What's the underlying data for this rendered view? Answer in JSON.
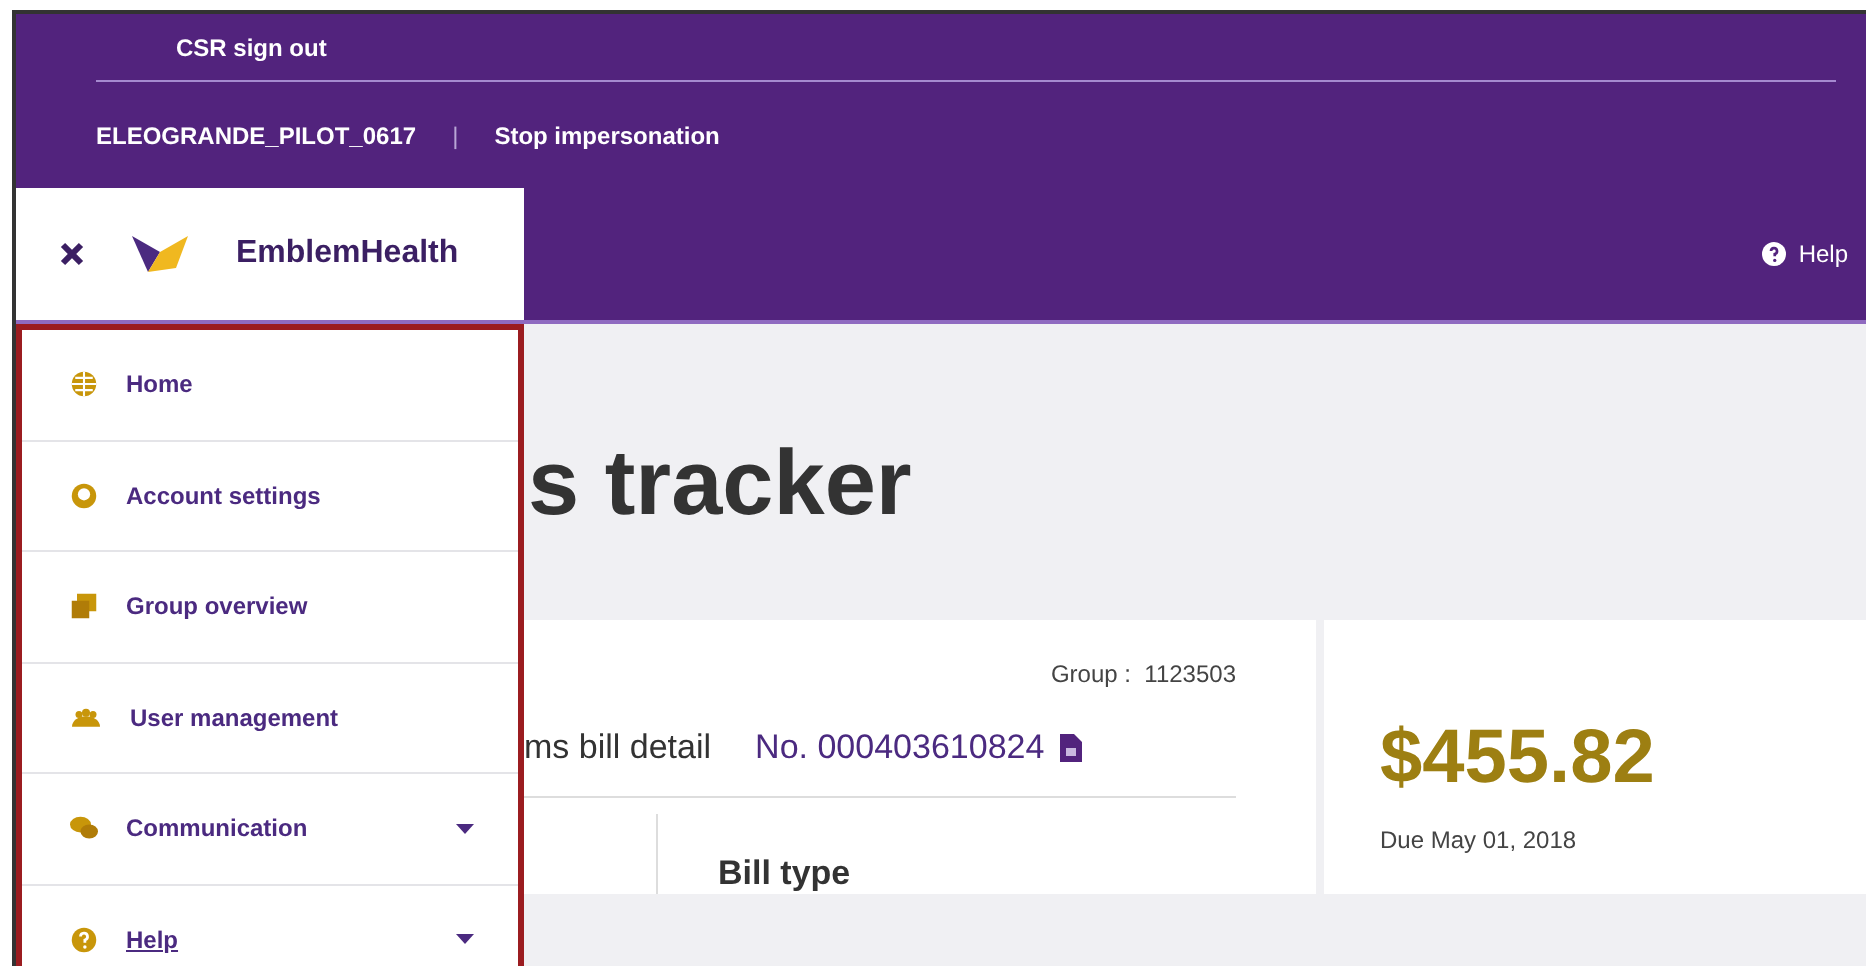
{
  "top_bar": {
    "sign_out": "CSR sign out",
    "user": "ELEOGRANDE_PILOT_0617",
    "separator": "|",
    "stop": "Stop impersonation"
  },
  "header": {
    "brand": "EmblemHealth",
    "help": "Help"
  },
  "sidebar": {
    "items": [
      {
        "label": "Home",
        "kind": "globe",
        "expandable": false,
        "underlined": false
      },
      {
        "label": "Account settings",
        "kind": "user",
        "expandable": false,
        "underlined": false
      },
      {
        "label": "Group overview",
        "kind": "cards",
        "expandable": false,
        "underlined": false
      },
      {
        "label": "User management",
        "kind": "users",
        "expandable": false,
        "underlined": false
      },
      {
        "label": "Communication",
        "kind": "chat",
        "expandable": true,
        "underlined": false
      },
      {
        "label": "Help",
        "kind": "help",
        "expandable": true,
        "underlined": true
      }
    ]
  },
  "main": {
    "title": "s tracker",
    "bill": {
      "group_label": "Group :",
      "group": "1123503",
      "heading": "ms bill detail",
      "number": "No. 000403610824",
      "bill_type": "Bill type"
    },
    "amount": {
      "value": "$455.82",
      "due": "Due May 01, 2018"
    }
  }
}
